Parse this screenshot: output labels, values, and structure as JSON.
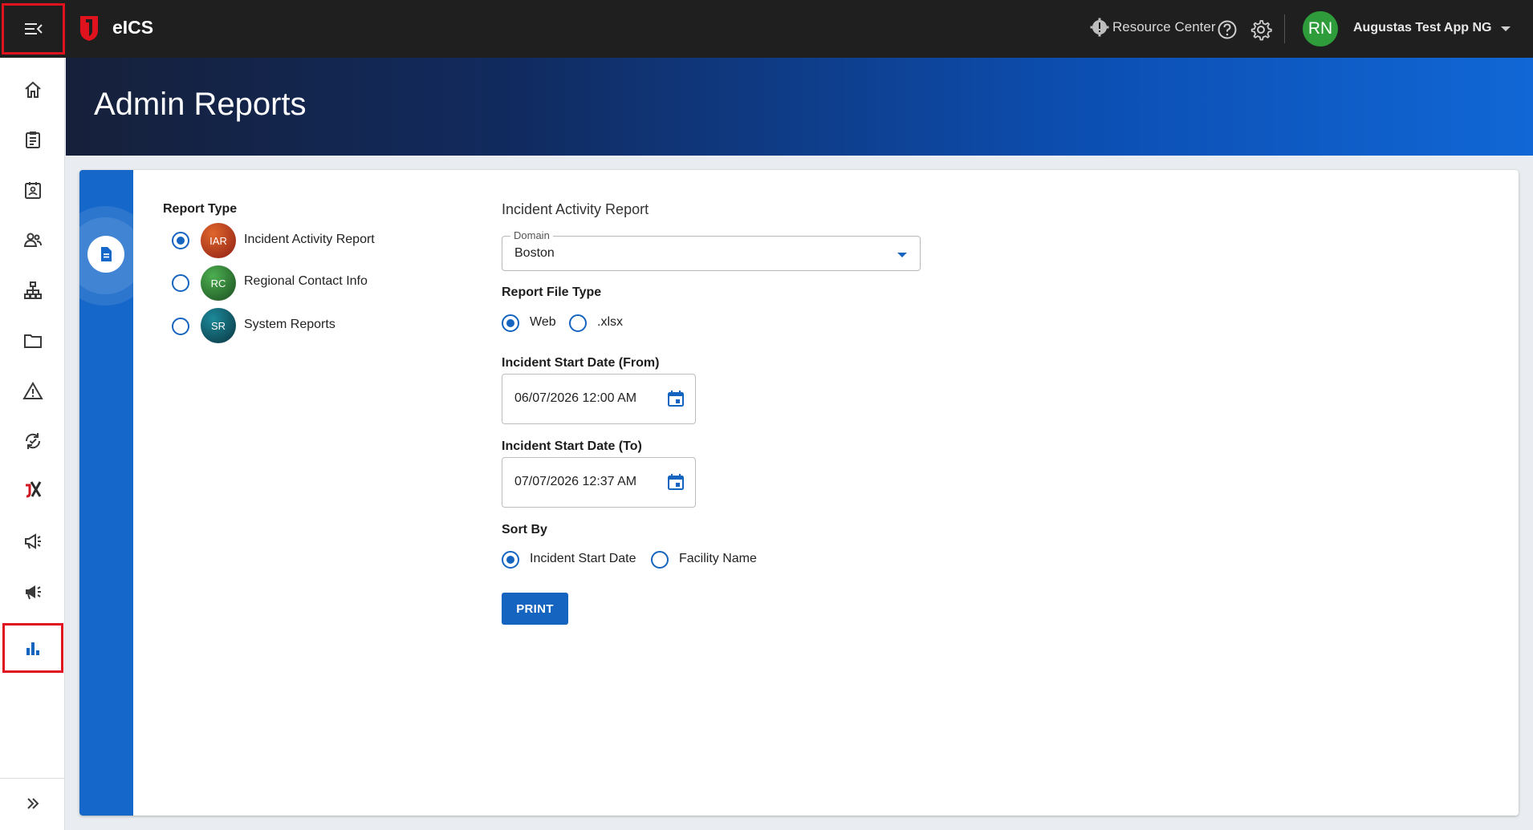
{
  "app": {
    "name": "eICS"
  },
  "topbar": {
    "resource_center": "Resource Center",
    "user_initials": "RN",
    "user_name": "Augustas Test App NG"
  },
  "sidebar": {
    "items": [
      {
        "icon": "home-icon"
      },
      {
        "icon": "clipboard-icon"
      },
      {
        "icon": "contact-card-icon"
      },
      {
        "icon": "people-icon"
      },
      {
        "icon": "org-chart-icon"
      },
      {
        "icon": "folder-icon"
      },
      {
        "icon": "warning-icon"
      },
      {
        "icon": "sync-check-icon"
      },
      {
        "icon": "brand-x-icon"
      },
      {
        "icon": "megaphone-icon"
      },
      {
        "icon": "megaphone-icon"
      },
      {
        "icon": "bar-chart-icon"
      }
    ],
    "expand_icon": "double-chevron-right-icon"
  },
  "page": {
    "title": "Admin Reports"
  },
  "report_type": {
    "label": "Report Type",
    "options": [
      {
        "badge": "IAR",
        "label": "Incident Activity Report",
        "selected": true,
        "color": "#c0392b"
      },
      {
        "badge": "RC",
        "label": "Regional Contact Info",
        "selected": false,
        "color": "#2e7d32"
      },
      {
        "badge": "SR",
        "label": "System Reports",
        "selected": false,
        "color": "#0e5a6b"
      }
    ]
  },
  "form": {
    "heading": "Incident Activity Report",
    "domain": {
      "label": "Domain",
      "value": "Boston"
    },
    "file_type": {
      "label": "Report File Type",
      "options": [
        "Web",
        ".xlsx"
      ],
      "selected": "Web"
    },
    "start_from": {
      "label": "Incident Start Date (From)",
      "value": "06/07/2026 12:00 AM"
    },
    "start_to": {
      "label": "Incident Start Date (To)",
      "value": "07/07/2026 12:37 AM"
    },
    "sort_by": {
      "label": "Sort By",
      "options": [
        "Incident Start Date",
        "Facility Name"
      ],
      "selected": "Incident Start Date"
    },
    "print_label": "PRINT"
  },
  "colors": {
    "accent": "#1565c0",
    "highlight": "#e0121e",
    "topbar": "#1f1f1f"
  }
}
